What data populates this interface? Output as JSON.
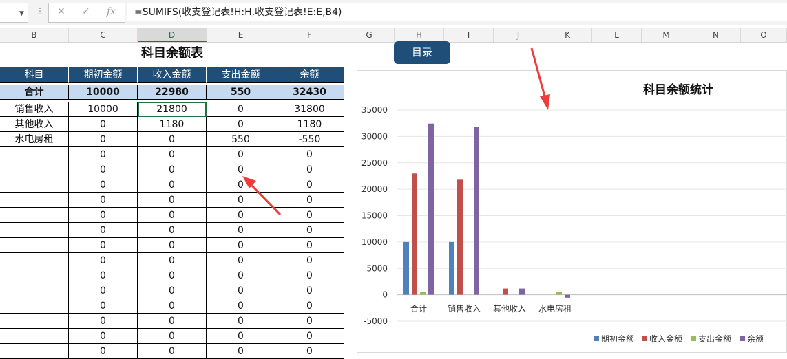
{
  "formula_bar": {
    "formula": "=SUMIFS(收支登记表!H:H,收支登记表!E:E,B4)",
    "cancel_icon": "✕",
    "enter_icon": "✓",
    "fx_icon": "fx"
  },
  "columns": [
    "B",
    "C",
    "D",
    "E",
    "F",
    "G",
    "H",
    "I",
    "J",
    "K",
    "L",
    "M",
    "N",
    "O"
  ],
  "active_column": "D",
  "sheet": {
    "title": "科目余额表",
    "menu_button": "目录",
    "headers": [
      "科目",
      "期初金额",
      "收入金额",
      "支出金额",
      "余额"
    ],
    "total_row": [
      "合计",
      "10000",
      "22980",
      "550",
      "32430"
    ],
    "rows": [
      [
        "销售收入",
        "10000",
        "21800",
        "0",
        "31800"
      ],
      [
        "其他收入",
        "0",
        "1180",
        "0",
        "1180"
      ],
      [
        "水电房租",
        "0",
        "0",
        "550",
        "-550"
      ],
      [
        "",
        "0",
        "0",
        "0",
        "0"
      ],
      [
        "",
        "0",
        "0",
        "0",
        "0"
      ],
      [
        "",
        "0",
        "0",
        "0",
        "0"
      ],
      [
        "",
        "0",
        "0",
        "0",
        "0"
      ],
      [
        "",
        "0",
        "0",
        "0",
        "0"
      ],
      [
        "",
        "0",
        "0",
        "0",
        "0"
      ],
      [
        "",
        "0",
        "0",
        "0",
        "0"
      ],
      [
        "",
        "0",
        "0",
        "0",
        "0"
      ],
      [
        "",
        "0",
        "0",
        "0",
        "0"
      ],
      [
        "",
        "0",
        "0",
        "0",
        "0"
      ],
      [
        "",
        "0",
        "0",
        "0",
        "0"
      ],
      [
        "",
        "0",
        "0",
        "0",
        "0"
      ],
      [
        "",
        "0",
        "0",
        "0",
        "0"
      ],
      [
        "",
        "0",
        "0",
        "0",
        "0"
      ]
    ],
    "selected_cell": "D5"
  },
  "colors": {
    "header_bg": "#1f4e79",
    "total_bg": "#c5d9f1",
    "annotation_arrow": "#ee3b3b"
  },
  "chart_data": {
    "type": "bar",
    "title": "科目余额统计",
    "categories": [
      "合计",
      "销售收入",
      "其他收入",
      "水电房租"
    ],
    "series": [
      {
        "name": "期初金额",
        "color": "#4f81bd",
        "values": [
          10000,
          10000,
          0,
          0
        ]
      },
      {
        "name": "收入金额",
        "color": "#c0504d",
        "values": [
          22980,
          21800,
          1180,
          0
        ]
      },
      {
        "name": "支出金额",
        "color": "#9bbb59",
        "values": [
          550,
          0,
          0,
          550
        ]
      },
      {
        "name": "余额",
        "color": "#8064a2",
        "values": [
          32430,
          31800,
          1180,
          -550
        ]
      }
    ],
    "yticks": [
      "35000",
      "30000",
      "25000",
      "20000",
      "15000",
      "10000",
      "5000",
      "0",
      "-5000"
    ],
    "ylim": [
      -5000,
      35000
    ],
    "grid": true,
    "legend": "bottom-right"
  }
}
